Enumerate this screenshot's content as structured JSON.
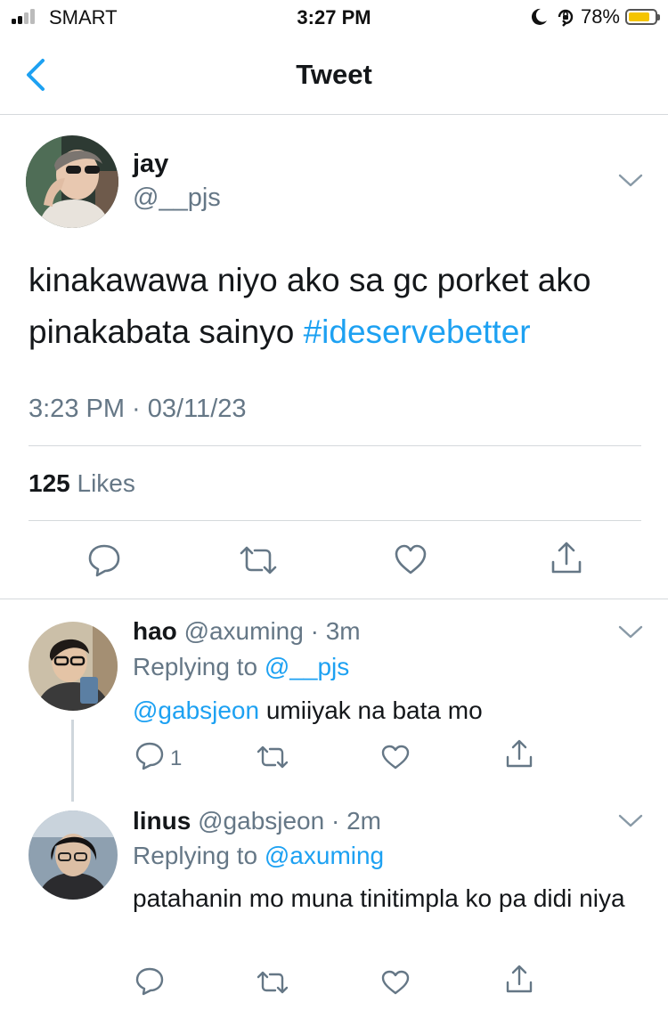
{
  "status_bar": {
    "carrier": "SMART",
    "time": "3:27 PM",
    "battery": "78%",
    "icons": [
      "signal-bars-icon",
      "moon-icon",
      "orientation-lock-icon",
      "battery-icon"
    ]
  },
  "nav": {
    "title": "Tweet",
    "back_icon": "chevron-left-icon"
  },
  "tweet": {
    "name": "jay",
    "handle": "@__pjs",
    "text": "kinakawawa niyo ako sa gc porket ako pinakabata sainyo ",
    "hashtag": "#ideservebetter",
    "timestamp": "3:23 PM · 03/11/23",
    "likes_count": "125",
    "likes_label": "Likes",
    "actions": [
      "reply-icon",
      "retweet-icon",
      "like-icon",
      "share-icon"
    ]
  },
  "replies": [
    {
      "name": "hao",
      "handle": "@axuming",
      "time": "· 3m",
      "replying_label": "Replying to",
      "replying_to": "@__pjs",
      "mention": "@gabsjeon",
      "text": " umiiyak na bata mo",
      "reply_count": "1"
    },
    {
      "name": "linus",
      "handle": "@gabsjeon",
      "time": "· 2m",
      "replying_label": "Replying to",
      "replying_to": "@axuming",
      "mention": "",
      "text": "patahanin mo muna tinitimpla ko pa didi niya",
      "reply_count": ""
    }
  ],
  "colors": {
    "link": "#1da1f2",
    "secondary_text": "#657786",
    "battery": "#f5c400",
    "divider": "#d5d9dc"
  }
}
